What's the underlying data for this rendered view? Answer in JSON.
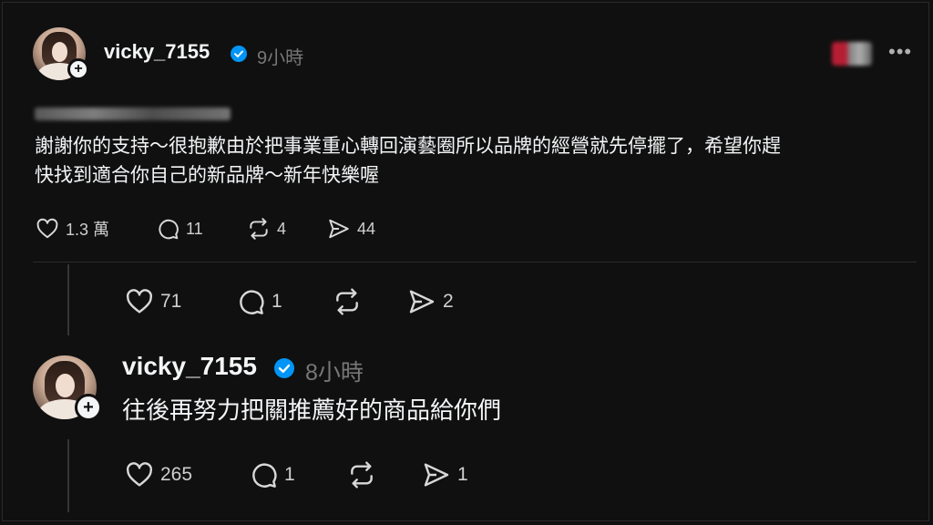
{
  "posts": [
    {
      "username": "vicky_7155",
      "time": "9小時",
      "quoted_redacted": "",
      "text_line1": "謝謝你的支持～很抱歉由於把事業重心轉回演藝圈所以品牌的經營就先停擺了，希望你趕",
      "text_line2": "快找到適合你自己的新品牌～新年快樂喔",
      "likes": "1.3 萬",
      "comments": "11",
      "reposts": "4",
      "shares": "44"
    }
  ],
  "reply_stats": {
    "likes": "71",
    "comments": "1",
    "reposts": "",
    "shares": "2"
  },
  "second_post": {
    "username": "vicky_7155",
    "time": "8小時",
    "text": "往後再努力把關推薦好的商品給你們",
    "likes": "265",
    "comments": "1",
    "reposts": "",
    "shares": "1"
  },
  "icons": {
    "like": "heart-icon",
    "comment": "comment-icon",
    "repost": "repost-icon",
    "share": "share-icon",
    "verified": "verified-badge-icon",
    "more": "more-options-icon",
    "follow": "plus-icon"
  },
  "colors": {
    "background": "#101010",
    "verified": "#0095f6",
    "muted": "#777777"
  }
}
